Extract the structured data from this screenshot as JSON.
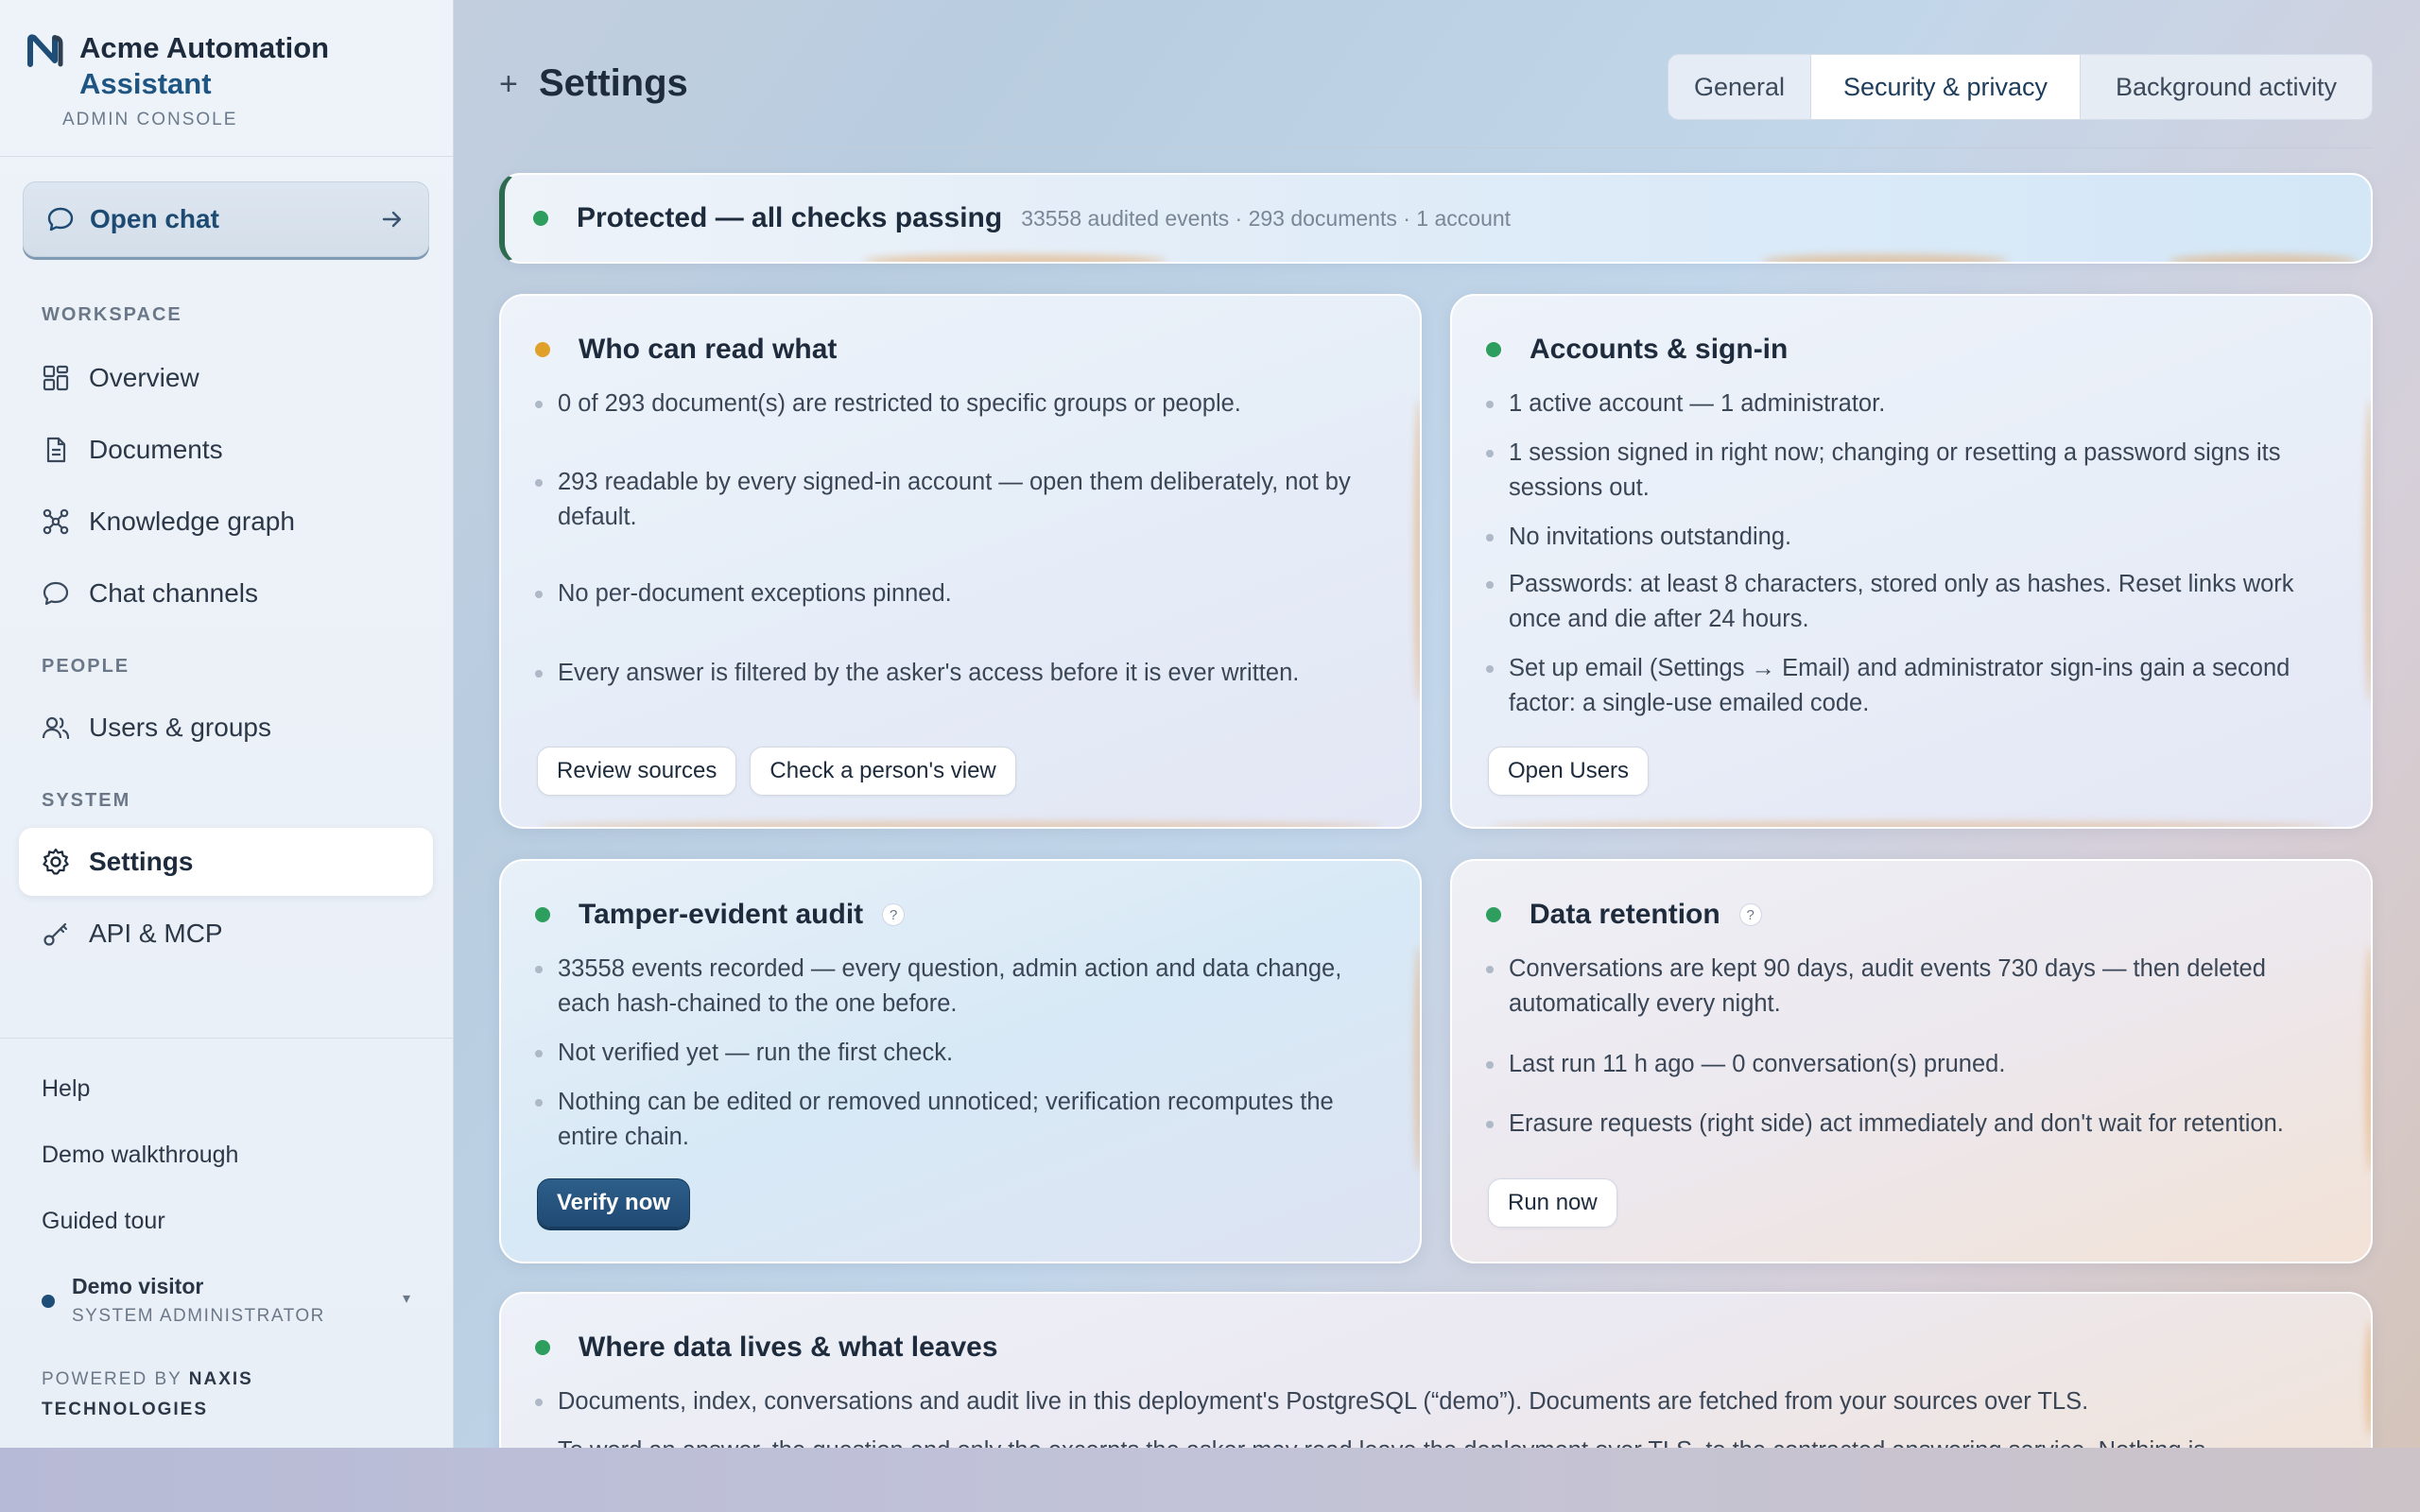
{
  "brand": {
    "name_line1": "Acme Automation",
    "name_line2": "Assistant",
    "subtitle": "ADMIN CONSOLE"
  },
  "sidebar": {
    "open_chat_label": "Open chat",
    "sections": {
      "workspace": "WORKSPACE",
      "people": "PEOPLE",
      "system": "SYSTEM"
    },
    "items": {
      "overview": "Overview",
      "documents": "Documents",
      "knowledge_graph": "Knowledge graph",
      "chat_channels": "Chat channels",
      "users_groups": "Users & groups",
      "settings": "Settings",
      "api_mcp": "API & MCP"
    },
    "footer_links": {
      "help": "Help",
      "demo_walkthrough": "Demo walkthrough",
      "guided_tour": "Guided tour"
    },
    "user": {
      "name": "Demo visitor",
      "role": "SYSTEM ADMINISTRATOR"
    },
    "powered_by_prefix": "POWERED BY",
    "powered_by_name": "NAXIS",
    "powered_by_suffix": "TECHNOLOGIES"
  },
  "header": {
    "title": "Settings",
    "tabs": [
      "General",
      "Security & privacy",
      "Background activity"
    ],
    "active_tab": "Security & privacy"
  },
  "banner": {
    "status": "Protected — all checks passing",
    "meta": "33558 audited events · 293 documents · 1 account",
    "status_color": "#2e9e5e"
  },
  "cards": {
    "read": {
      "title": "Who can read what",
      "status_color": "#e0a12a",
      "items": [
        "0 of 293 document(s) are restricted to specific groups or people.",
        "293 readable by every signed-in account — open them deliberately, not by default.",
        "No per-document exceptions pinned.",
        "Every answer is filtered by the asker's access before it is ever written."
      ],
      "buttons": [
        "Review sources",
        "Check a person's view"
      ]
    },
    "accounts": {
      "title": "Accounts & sign-in",
      "status_color": "#2e9e5e",
      "items": [
        "1 active account — 1 administrator.",
        "1 session signed in right now; changing or resetting a password signs its sessions out.",
        "No invitations outstanding.",
        "Passwords: at least 8 characters, stored only as hashes. Reset links work once and die after 24 hours.",
        "Set up email (Settings → Email) and administrator sign-ins gain a second factor: a single-use emailed code."
      ],
      "buttons": [
        "Open Users"
      ]
    },
    "audit": {
      "title": "Tamper-evident audit",
      "help": "?",
      "status_color": "#2e9e5e",
      "items": [
        "33558 events recorded — every question, admin action and data change, each hash-chained to the one before.",
        "Not verified yet — run the first check.",
        "Nothing can be edited or removed unnoticed; verification recomputes the entire chain."
      ],
      "buttons": [
        "Verify now"
      ]
    },
    "retention": {
      "title": "Data retention",
      "help": "?",
      "status_color": "#2e9e5e",
      "items": [
        "Conversations are kept 90 days, audit events 730 days — then deleted automatically every night.",
        "Last run 11 h ago — 0 conversation(s) pruned.",
        "Erasure requests (right side) act immediately and don't wait for retention."
      ],
      "buttons": [
        "Run now"
      ]
    },
    "data": {
      "title": "Where data lives & what leaves",
      "status_color": "#2e9e5e",
      "items": [
        "Documents, index, conversations and audit live in this deployment's PostgreSQL (“demo”). Documents are fetched from your sources over TLS.",
        "To word an answer, the question and only the excerpts the asker may read leave the deployment over TLS, to the contracted answering service. Nothing is"
      ]
    }
  }
}
